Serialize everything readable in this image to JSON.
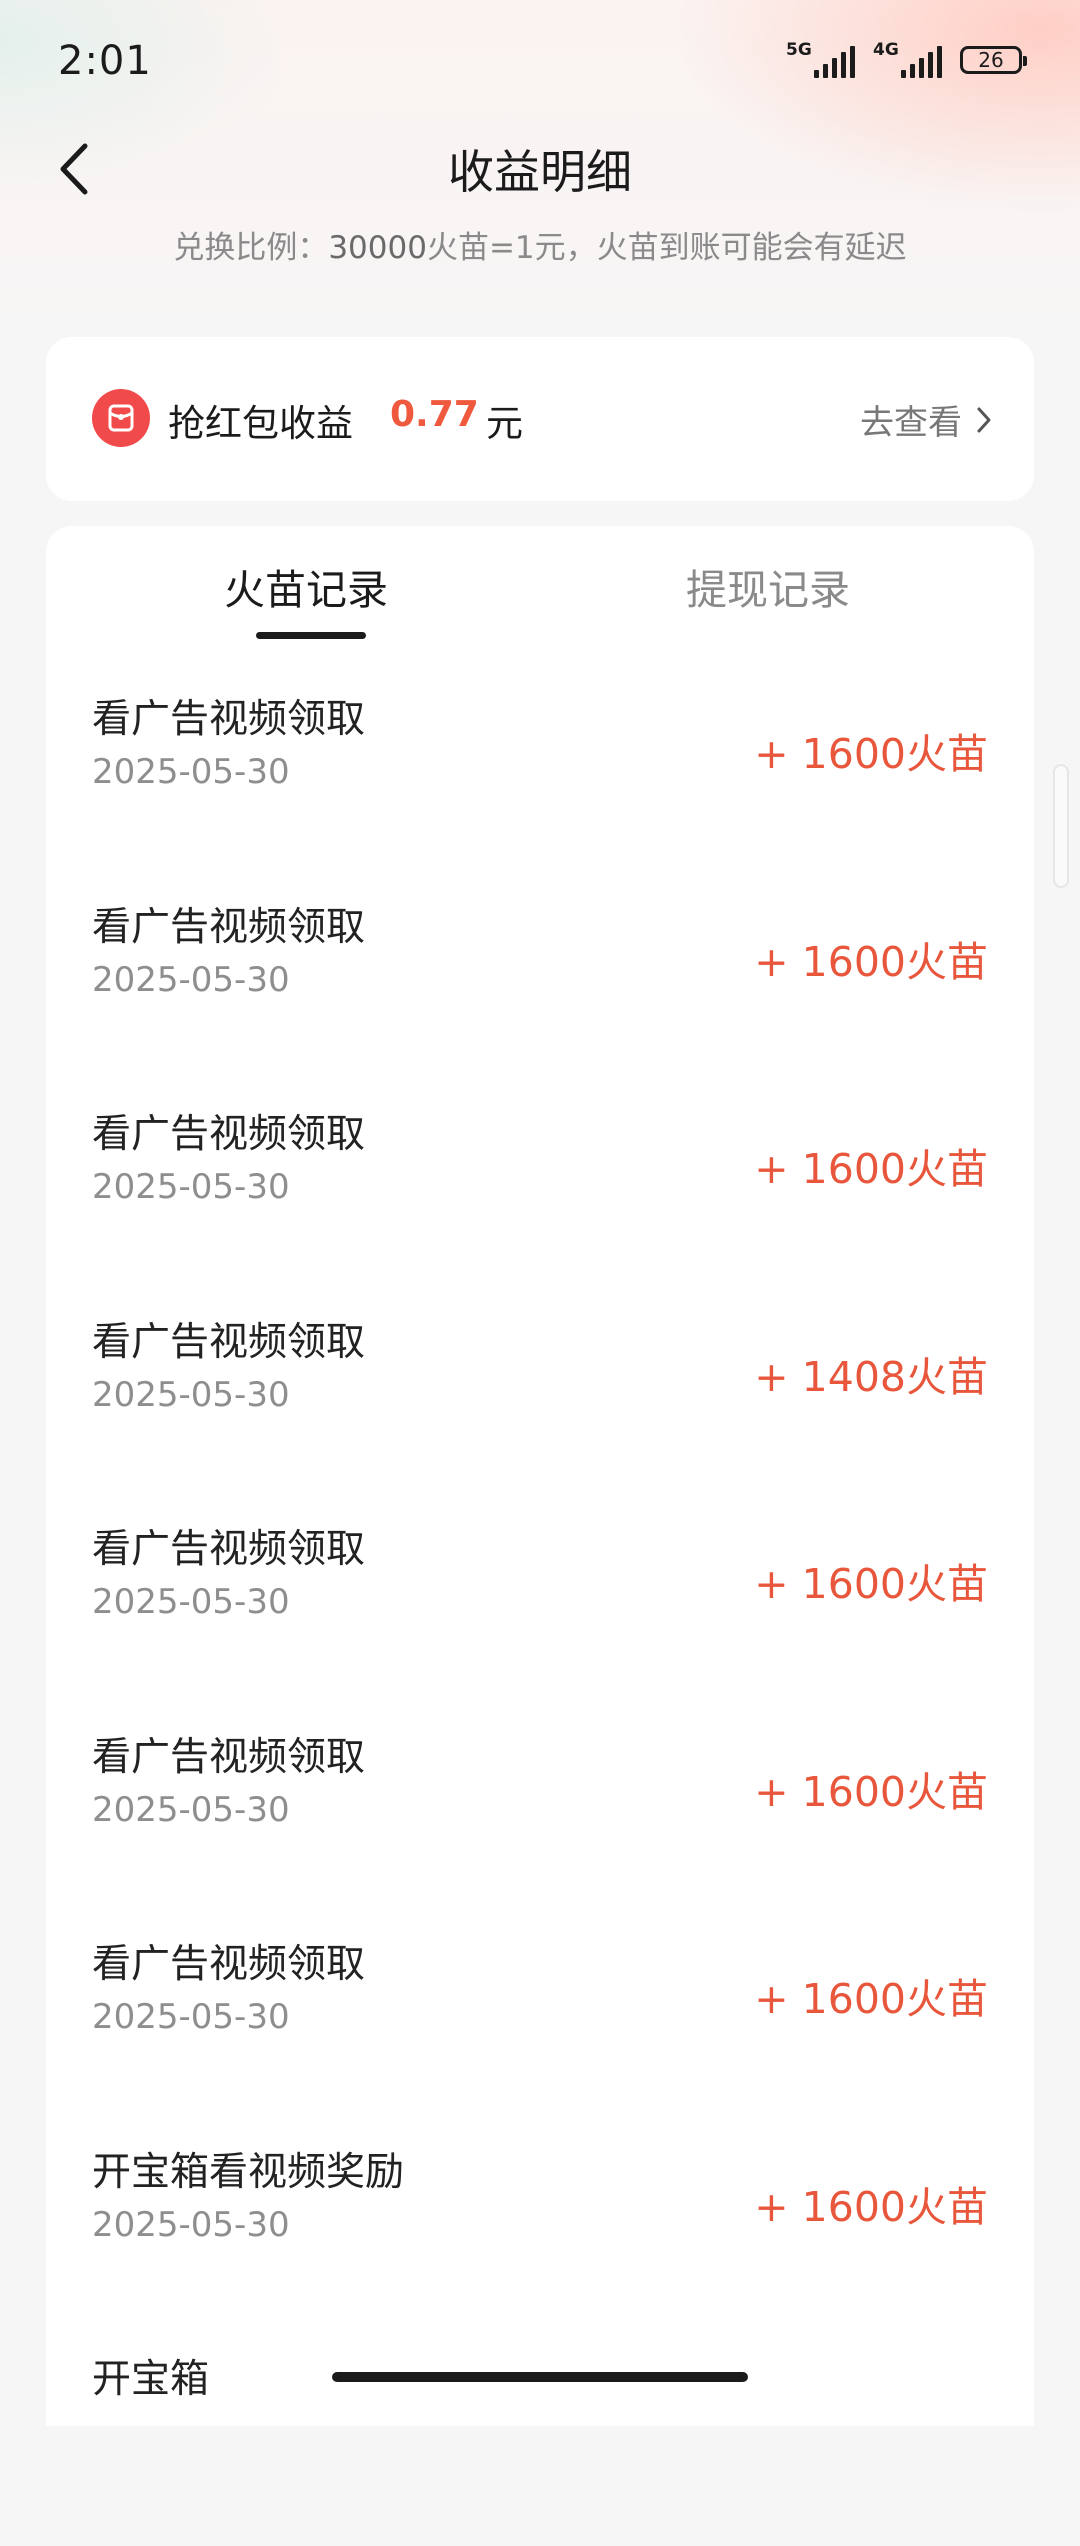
{
  "status_bar": {
    "time": "2:01",
    "network_1": "5G",
    "network_2": "4G",
    "battery": "26"
  },
  "header": {
    "title": "收益明细",
    "exchange_prefix": "兑换比例：",
    "exchange_amount": "30000",
    "exchange_suffix": "火苗=1元，火苗到账可能会有延迟"
  },
  "red_packet": {
    "label": "抢红包收益",
    "amount": "0.77",
    "unit": "元",
    "link": "去查看"
  },
  "tabs": [
    {
      "label": "火苗记录",
      "active": true
    },
    {
      "label": "提现记录",
      "active": false
    }
  ],
  "records": [
    {
      "title": "看广告视频领取",
      "date": "2025-05-30",
      "amount": "+ 1600火苗"
    },
    {
      "title": "看广告视频领取",
      "date": "2025-05-30",
      "amount": "+ 1600火苗"
    },
    {
      "title": "看广告视频领取",
      "date": "2025-05-30",
      "amount": "+ 1600火苗"
    },
    {
      "title": "看广告视频领取",
      "date": "2025-05-30",
      "amount": "+ 1408火苗"
    },
    {
      "title": "看广告视频领取",
      "date": "2025-05-30",
      "amount": "+ 1600火苗"
    },
    {
      "title": "看广告视频领取",
      "date": "2025-05-30",
      "amount": "+ 1600火苗"
    },
    {
      "title": "看广告视频领取",
      "date": "2025-05-30",
      "amount": "+ 1600火苗"
    },
    {
      "title": "开宝箱看视频奖励",
      "date": "2025-05-30",
      "amount": "+ 1600火苗"
    },
    {
      "title": "开宝箱",
      "date": "",
      "amount": ""
    }
  ],
  "colors": {
    "accent": "#e8573c",
    "red_packet": "#f04a4a"
  }
}
